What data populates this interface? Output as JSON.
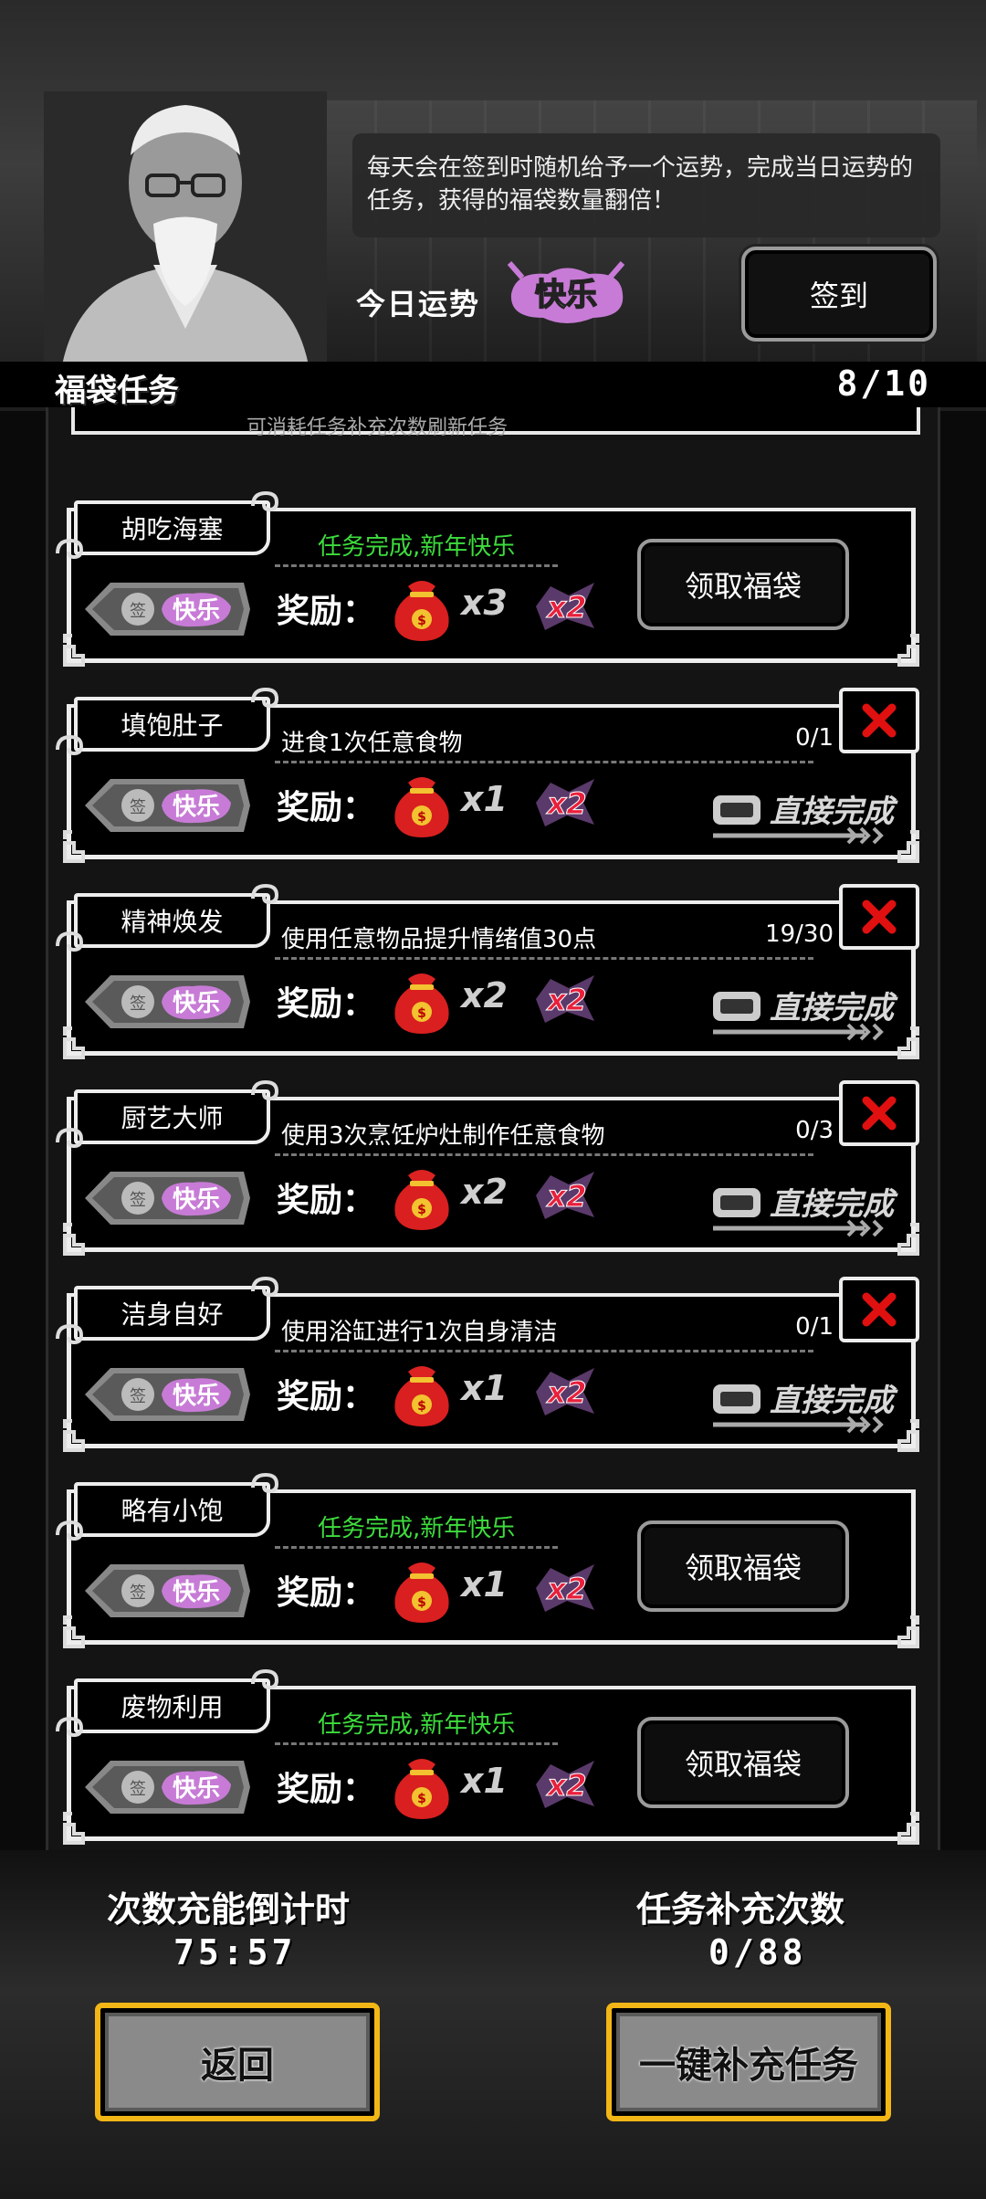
{
  "header": {
    "info_text": "每天会在签到时随机给予一个运势，完成当日运势的任务，获得的福袋数量翻倍！",
    "luck_label": "今日运势",
    "luck_value": "快乐",
    "signin_button": "签到"
  },
  "section": {
    "title": "福袋任务",
    "count": "8/10",
    "partial_text": "可消耗任务补充次数刷新任务"
  },
  "common": {
    "reward_label": "奖励：",
    "double_label": "x2",
    "finish_label": "直接完成",
    "claim_label": "领取福袋",
    "luck_tag_sign": "签",
    "luck_tag_value": "快乐"
  },
  "tasks": [
    {
      "name": "胡吃海塞",
      "desc": "任务完成,新年快乐",
      "progress": "",
      "multiplier": "x3",
      "completed": true
    },
    {
      "name": "填饱肚子",
      "desc": "进食1次任意食物",
      "progress": "0/1",
      "multiplier": "x1",
      "completed": false
    },
    {
      "name": "精神焕发",
      "desc": "使用任意物品提升情绪值30点",
      "progress": "19/30",
      "multiplier": "x2",
      "completed": false
    },
    {
      "name": "厨艺大师",
      "desc": "使用3次烹饪炉灶制作任意食物",
      "progress": "0/3",
      "multiplier": "x2",
      "completed": false
    },
    {
      "name": "洁身自好",
      "desc": "使用浴缸进行1次自身清洁",
      "progress": "0/1",
      "multiplier": "x1",
      "completed": false
    },
    {
      "name": "略有小饱",
      "desc": "任务完成,新年快乐",
      "progress": "",
      "multiplier": "x1",
      "completed": true
    },
    {
      "name": "废物利用",
      "desc": "任务完成,新年快乐",
      "progress": "",
      "multiplier": "x1",
      "completed": true
    }
  ],
  "footer": {
    "countdown_label": "次数充能倒计时",
    "countdown_value": "75:57",
    "refill_label": "任务补充次数",
    "refill_value": "0/88",
    "back_button": "返回",
    "refill_button": "一键补充任务"
  },
  "colors": {
    "completed_text": "#3ddc3d",
    "luck_purple": "#c77bd6",
    "double_red": "#e8203c",
    "button_gold": "#f2b616",
    "cancel_red": "#e01010"
  }
}
